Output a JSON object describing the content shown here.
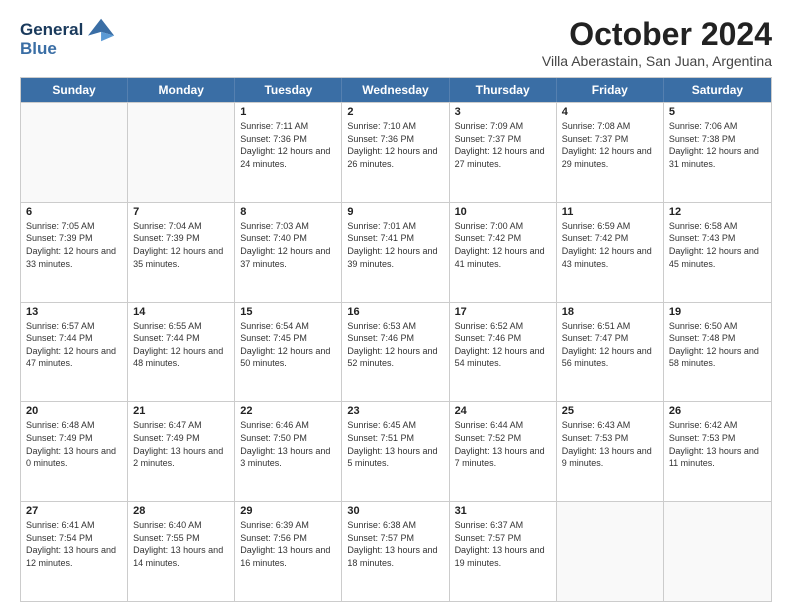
{
  "header": {
    "logo_line1": "General",
    "logo_line2": "Blue",
    "month": "October 2024",
    "location": "Villa Aberastain, San Juan, Argentina"
  },
  "days_of_week": [
    "Sunday",
    "Monday",
    "Tuesday",
    "Wednesday",
    "Thursday",
    "Friday",
    "Saturday"
  ],
  "weeks": [
    [
      {
        "day": "",
        "info": ""
      },
      {
        "day": "",
        "info": ""
      },
      {
        "day": "1",
        "info": "Sunrise: 7:11 AM\nSunset: 7:36 PM\nDaylight: 12 hours and 24 minutes."
      },
      {
        "day": "2",
        "info": "Sunrise: 7:10 AM\nSunset: 7:36 PM\nDaylight: 12 hours and 26 minutes."
      },
      {
        "day": "3",
        "info": "Sunrise: 7:09 AM\nSunset: 7:37 PM\nDaylight: 12 hours and 27 minutes."
      },
      {
        "day": "4",
        "info": "Sunrise: 7:08 AM\nSunset: 7:37 PM\nDaylight: 12 hours and 29 minutes."
      },
      {
        "day": "5",
        "info": "Sunrise: 7:06 AM\nSunset: 7:38 PM\nDaylight: 12 hours and 31 minutes."
      }
    ],
    [
      {
        "day": "6",
        "info": "Sunrise: 7:05 AM\nSunset: 7:39 PM\nDaylight: 12 hours and 33 minutes."
      },
      {
        "day": "7",
        "info": "Sunrise: 7:04 AM\nSunset: 7:39 PM\nDaylight: 12 hours and 35 minutes."
      },
      {
        "day": "8",
        "info": "Sunrise: 7:03 AM\nSunset: 7:40 PM\nDaylight: 12 hours and 37 minutes."
      },
      {
        "day": "9",
        "info": "Sunrise: 7:01 AM\nSunset: 7:41 PM\nDaylight: 12 hours and 39 minutes."
      },
      {
        "day": "10",
        "info": "Sunrise: 7:00 AM\nSunset: 7:42 PM\nDaylight: 12 hours and 41 minutes."
      },
      {
        "day": "11",
        "info": "Sunrise: 6:59 AM\nSunset: 7:42 PM\nDaylight: 12 hours and 43 minutes."
      },
      {
        "day": "12",
        "info": "Sunrise: 6:58 AM\nSunset: 7:43 PM\nDaylight: 12 hours and 45 minutes."
      }
    ],
    [
      {
        "day": "13",
        "info": "Sunrise: 6:57 AM\nSunset: 7:44 PM\nDaylight: 12 hours and 47 minutes."
      },
      {
        "day": "14",
        "info": "Sunrise: 6:55 AM\nSunset: 7:44 PM\nDaylight: 12 hours and 48 minutes."
      },
      {
        "day": "15",
        "info": "Sunrise: 6:54 AM\nSunset: 7:45 PM\nDaylight: 12 hours and 50 minutes."
      },
      {
        "day": "16",
        "info": "Sunrise: 6:53 AM\nSunset: 7:46 PM\nDaylight: 12 hours and 52 minutes."
      },
      {
        "day": "17",
        "info": "Sunrise: 6:52 AM\nSunset: 7:46 PM\nDaylight: 12 hours and 54 minutes."
      },
      {
        "day": "18",
        "info": "Sunrise: 6:51 AM\nSunset: 7:47 PM\nDaylight: 12 hours and 56 minutes."
      },
      {
        "day": "19",
        "info": "Sunrise: 6:50 AM\nSunset: 7:48 PM\nDaylight: 12 hours and 58 minutes."
      }
    ],
    [
      {
        "day": "20",
        "info": "Sunrise: 6:48 AM\nSunset: 7:49 PM\nDaylight: 13 hours and 0 minutes."
      },
      {
        "day": "21",
        "info": "Sunrise: 6:47 AM\nSunset: 7:49 PM\nDaylight: 13 hours and 2 minutes."
      },
      {
        "day": "22",
        "info": "Sunrise: 6:46 AM\nSunset: 7:50 PM\nDaylight: 13 hours and 3 minutes."
      },
      {
        "day": "23",
        "info": "Sunrise: 6:45 AM\nSunset: 7:51 PM\nDaylight: 13 hours and 5 minutes."
      },
      {
        "day": "24",
        "info": "Sunrise: 6:44 AM\nSunset: 7:52 PM\nDaylight: 13 hours and 7 minutes."
      },
      {
        "day": "25",
        "info": "Sunrise: 6:43 AM\nSunset: 7:53 PM\nDaylight: 13 hours and 9 minutes."
      },
      {
        "day": "26",
        "info": "Sunrise: 6:42 AM\nSunset: 7:53 PM\nDaylight: 13 hours and 11 minutes."
      }
    ],
    [
      {
        "day": "27",
        "info": "Sunrise: 6:41 AM\nSunset: 7:54 PM\nDaylight: 13 hours and 12 minutes."
      },
      {
        "day": "28",
        "info": "Sunrise: 6:40 AM\nSunset: 7:55 PM\nDaylight: 13 hours and 14 minutes."
      },
      {
        "day": "29",
        "info": "Sunrise: 6:39 AM\nSunset: 7:56 PM\nDaylight: 13 hours and 16 minutes."
      },
      {
        "day": "30",
        "info": "Sunrise: 6:38 AM\nSunset: 7:57 PM\nDaylight: 13 hours and 18 minutes."
      },
      {
        "day": "31",
        "info": "Sunrise: 6:37 AM\nSunset: 7:57 PM\nDaylight: 13 hours and 19 minutes."
      },
      {
        "day": "",
        "info": ""
      },
      {
        "day": "",
        "info": ""
      }
    ]
  ]
}
